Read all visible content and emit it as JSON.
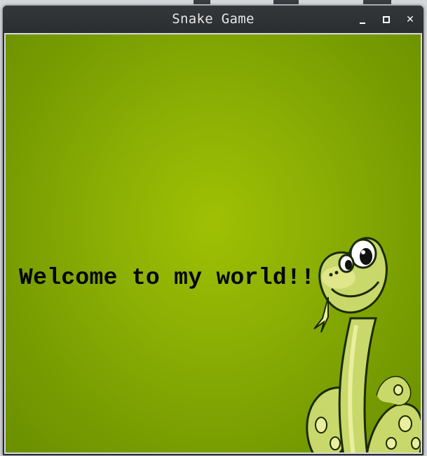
{
  "window": {
    "title": "Snake Game",
    "controls": {
      "minimize_icon": "minimize-icon",
      "maximize_icon": "maximize-icon",
      "close_label": "✕"
    }
  },
  "game": {
    "welcome_text": "Welcome to my world!!",
    "background_color": "#8cb004",
    "text_color": "#050505",
    "mascot": "cartoon-snake"
  }
}
